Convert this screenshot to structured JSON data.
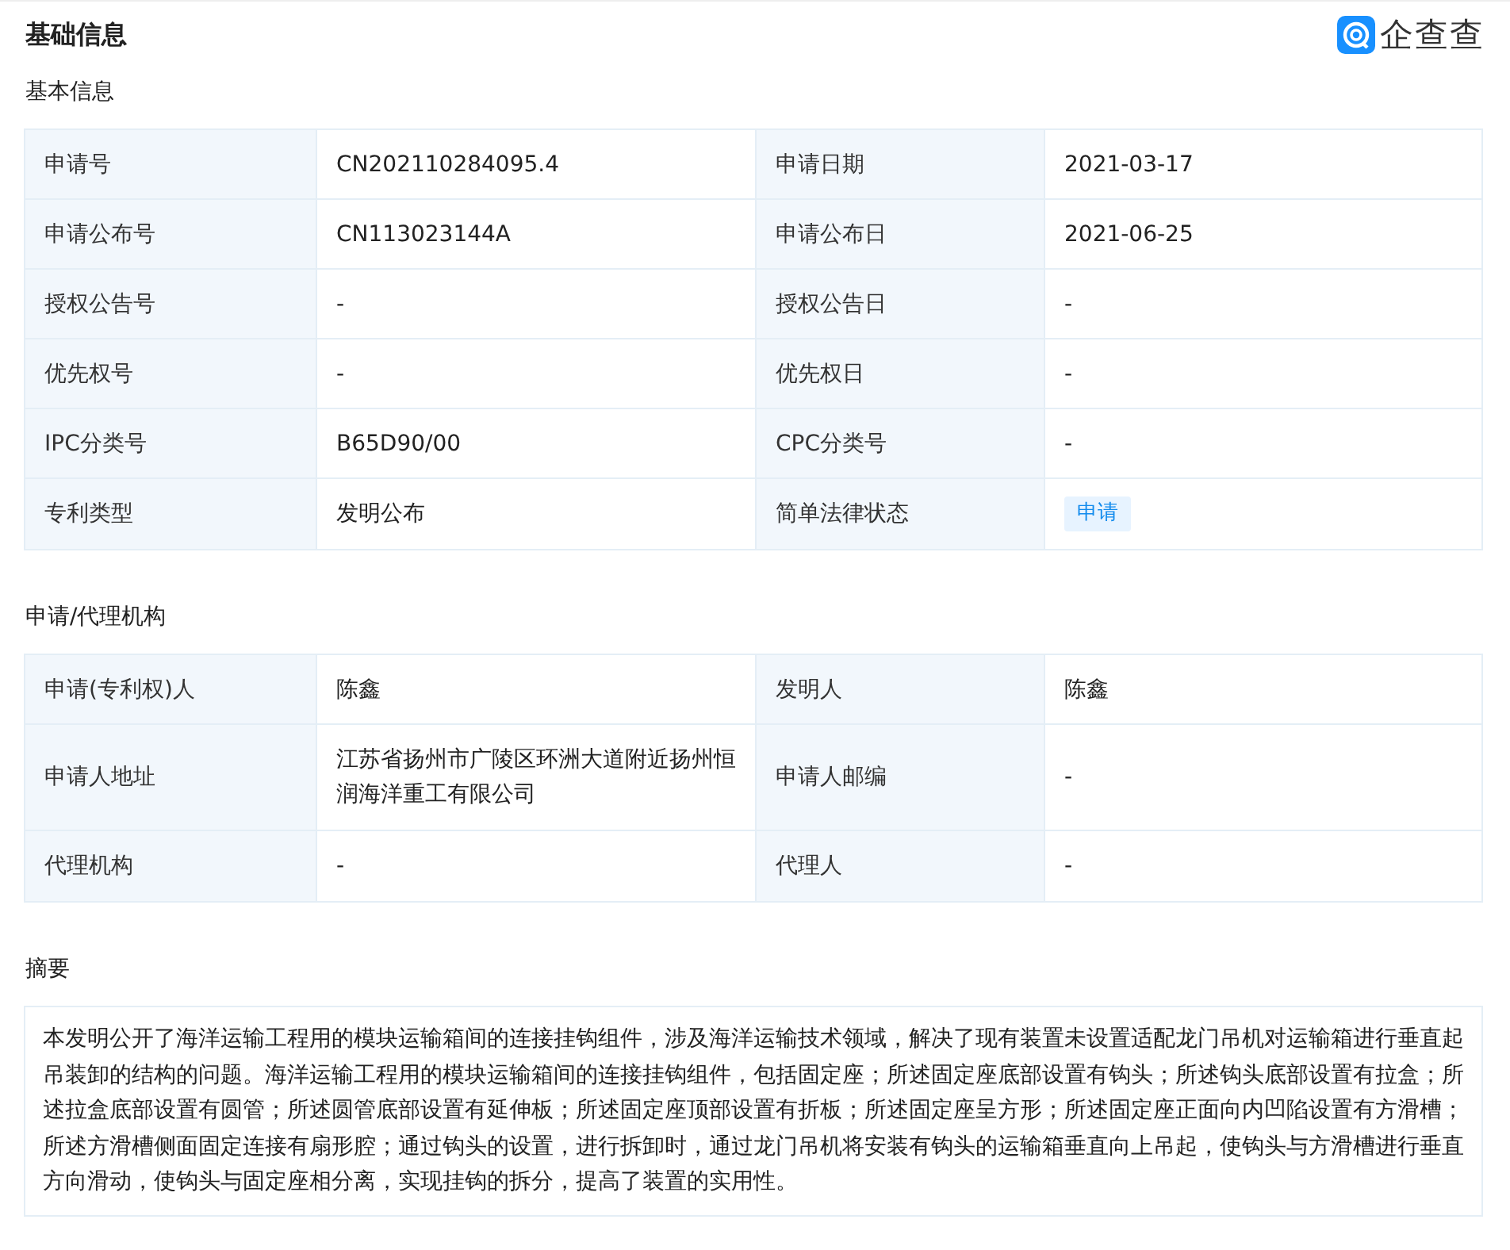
{
  "header": {
    "title": "基础信息",
    "logo_text": "企查查"
  },
  "sections": [
    {
      "title": "基本信息",
      "kind": "table",
      "rows": [
        [
          {
            "kind": "label",
            "text": "申请号"
          },
          {
            "kind": "value",
            "text": "CN202110284095.4"
          },
          {
            "kind": "label",
            "text": "申请日期"
          },
          {
            "kind": "value",
            "text": "2021-03-17"
          }
        ],
        [
          {
            "kind": "label",
            "text": "申请公布号"
          },
          {
            "kind": "value",
            "text": "CN113023144A"
          },
          {
            "kind": "label",
            "text": "申请公布日"
          },
          {
            "kind": "value",
            "text": "2021-06-25"
          }
        ],
        [
          {
            "kind": "label",
            "text": "授权公告号"
          },
          {
            "kind": "value",
            "text": "-"
          },
          {
            "kind": "label",
            "text": "授权公告日"
          },
          {
            "kind": "value",
            "text": "-"
          }
        ],
        [
          {
            "kind": "label",
            "text": "优先权号"
          },
          {
            "kind": "value",
            "text": "-"
          },
          {
            "kind": "label",
            "text": "优先权日"
          },
          {
            "kind": "value",
            "text": "-"
          }
        ],
        [
          {
            "kind": "label",
            "text": "IPC分类号"
          },
          {
            "kind": "value",
            "text": "B65D90/00"
          },
          {
            "kind": "label",
            "text": "CPC分类号"
          },
          {
            "kind": "value",
            "text": "-"
          }
        ],
        [
          {
            "kind": "label",
            "text": "专利类型"
          },
          {
            "kind": "value",
            "text": "发明公布"
          },
          {
            "kind": "label",
            "text": "简单法律状态"
          },
          {
            "kind": "tag",
            "text": "申请"
          }
        ]
      ]
    },
    {
      "title": "申请/代理机构",
      "kind": "table",
      "rows": [
        [
          {
            "kind": "label",
            "text": "申请(专利权)人"
          },
          {
            "kind": "value",
            "text": "陈鑫"
          },
          {
            "kind": "label",
            "text": "发明人"
          },
          {
            "kind": "value",
            "text": "陈鑫"
          }
        ],
        [
          {
            "kind": "label",
            "text": "申请人地址"
          },
          {
            "kind": "value",
            "text": "江苏省扬州市广陵区环洲大道附近扬州恒润海洋重工有限公司"
          },
          {
            "kind": "label",
            "text": "申请人邮编"
          },
          {
            "kind": "value",
            "text": "-"
          }
        ],
        [
          {
            "kind": "label",
            "text": "代理机构"
          },
          {
            "kind": "value",
            "text": "-"
          },
          {
            "kind": "label",
            "text": "代理人"
          },
          {
            "kind": "value",
            "text": "-"
          }
        ]
      ]
    },
    {
      "title": "摘要",
      "kind": "text",
      "text": "本发明公开了海洋运输工程用的模块运输箱间的连接挂钩组件，涉及海洋运输技术领域，解决了现有装置未设置适配龙门吊机对运输箱进行垂直起吊装卸的结构的问题。海洋运输工程用的模块运输箱间的连接挂钩组件，包括固定座；所述固定座底部设置有钩头；所述钩头底部设置有拉盒；所述拉盒底部设置有圆管；所述圆管底部设置有延伸板；所述固定座顶部设置有折板；所述固定座呈方形；所述固定座正面向内凹陷设置有方滑槽；所述方滑槽侧面固定连接有扇形腔；通过钩头的设置，进行拆卸时，通过龙门吊机将安装有钩头的运输箱垂直向上吊起，使钩头与方滑槽进行垂直方向滑动，使钩头与固定座相分离，实现挂钩的拆分，提高了装置的实用性。"
    }
  ]
}
